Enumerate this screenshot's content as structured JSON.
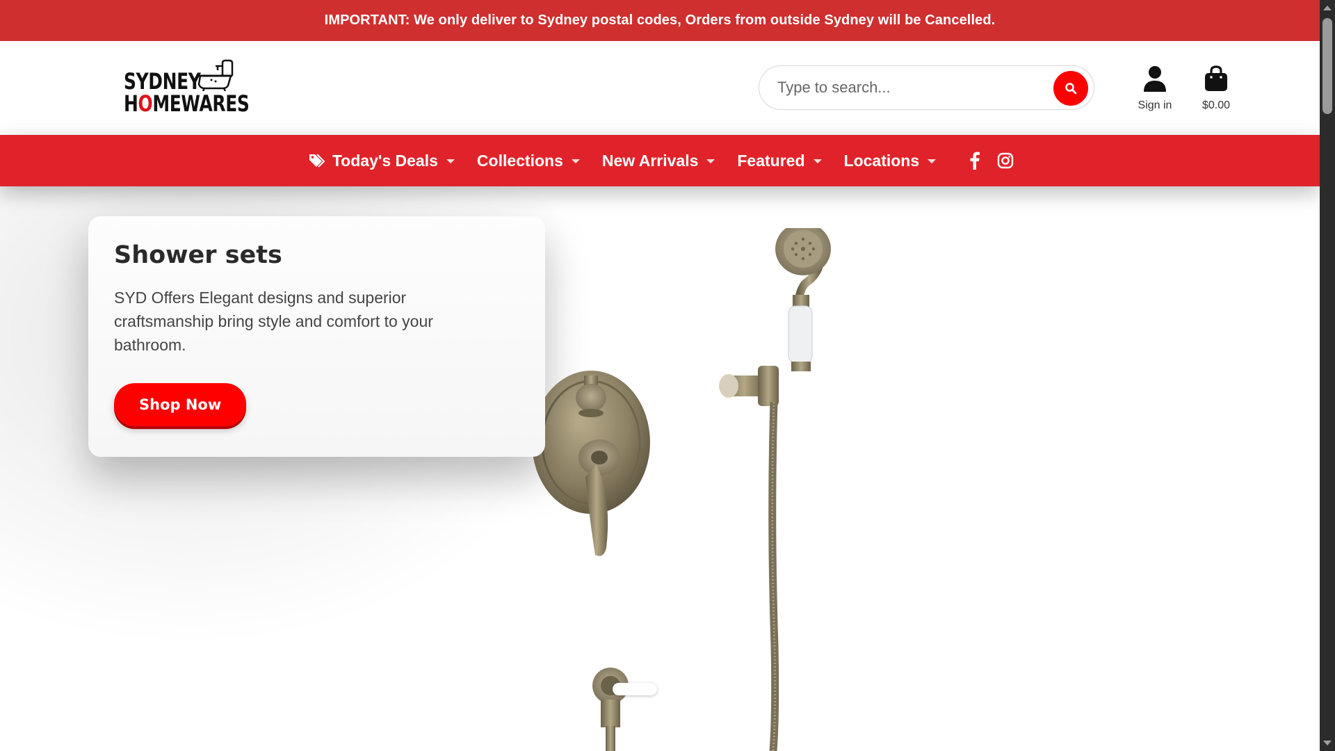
{
  "announcement": {
    "text": "IMPORTANT: We only deliver to Sydney postal codes, Orders from outside Sydney will be Cancelled."
  },
  "header": {
    "logo_line1": "SYDNEY",
    "logo_line2_pre": "H",
    "logo_line2_accent": "O",
    "logo_line2_post": "MEWARES",
    "search_placeholder": "Type to search...",
    "signin_label": "Sign in",
    "cart_total": "$0.00"
  },
  "nav": {
    "items": [
      {
        "label": "Today's Deals",
        "icon": "tag-icon"
      },
      {
        "label": "Collections"
      },
      {
        "label": "New Arrivals"
      },
      {
        "label": "Featured"
      },
      {
        "label": "Locations"
      }
    ],
    "social": [
      "facebook-icon",
      "instagram-icon"
    ]
  },
  "hero": {
    "title": "Shower sets",
    "description": "SYD Offers Elegant designs and superior craftsmanship bring style and comfort to your bathroom.",
    "cta_label": "Shop Now"
  },
  "colors": {
    "announcement_bg": "#cf2f2f",
    "nav_bg": "#e0232a",
    "accent": "#ff0000",
    "brass": "#8a7f62"
  }
}
